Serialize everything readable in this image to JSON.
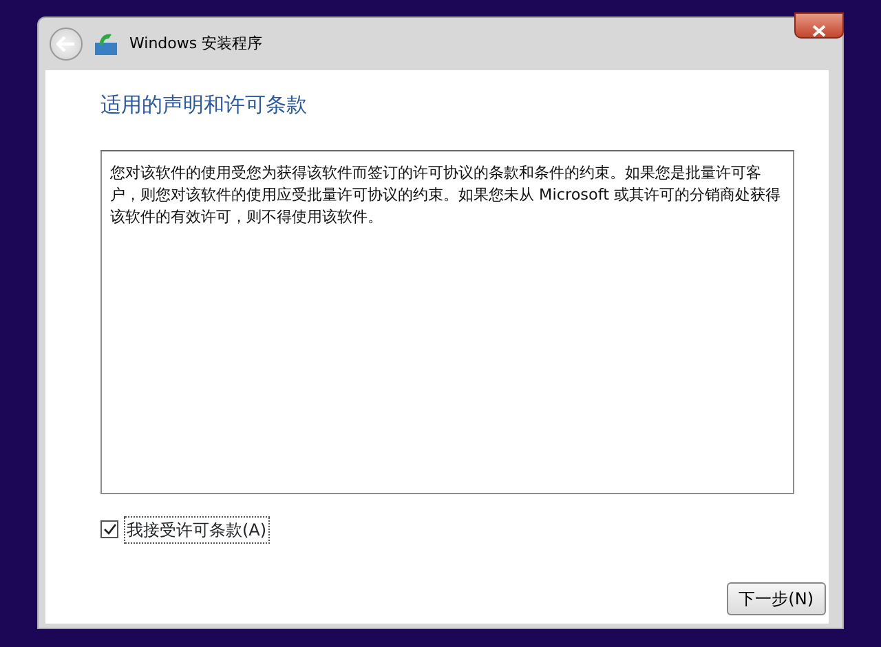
{
  "window": {
    "title": "Windows 安装程序"
  },
  "heading": "适用的声明和许可条款",
  "license_text": "您对该软件的使用受您为获得该软件而签订的许可协议的条款和条件的约束。如果您是批量许可客户，则您对该软件的使用应受批量许可协议的约束。如果您未从 Microsoft 或其许可的分销商处获得该软件的有效许可，则不得使用该软件。",
  "accept": {
    "label": "我接受许可条款(A)",
    "checked": true
  },
  "buttons": [
    {
      "label": "下一步(N)"
    }
  ]
}
